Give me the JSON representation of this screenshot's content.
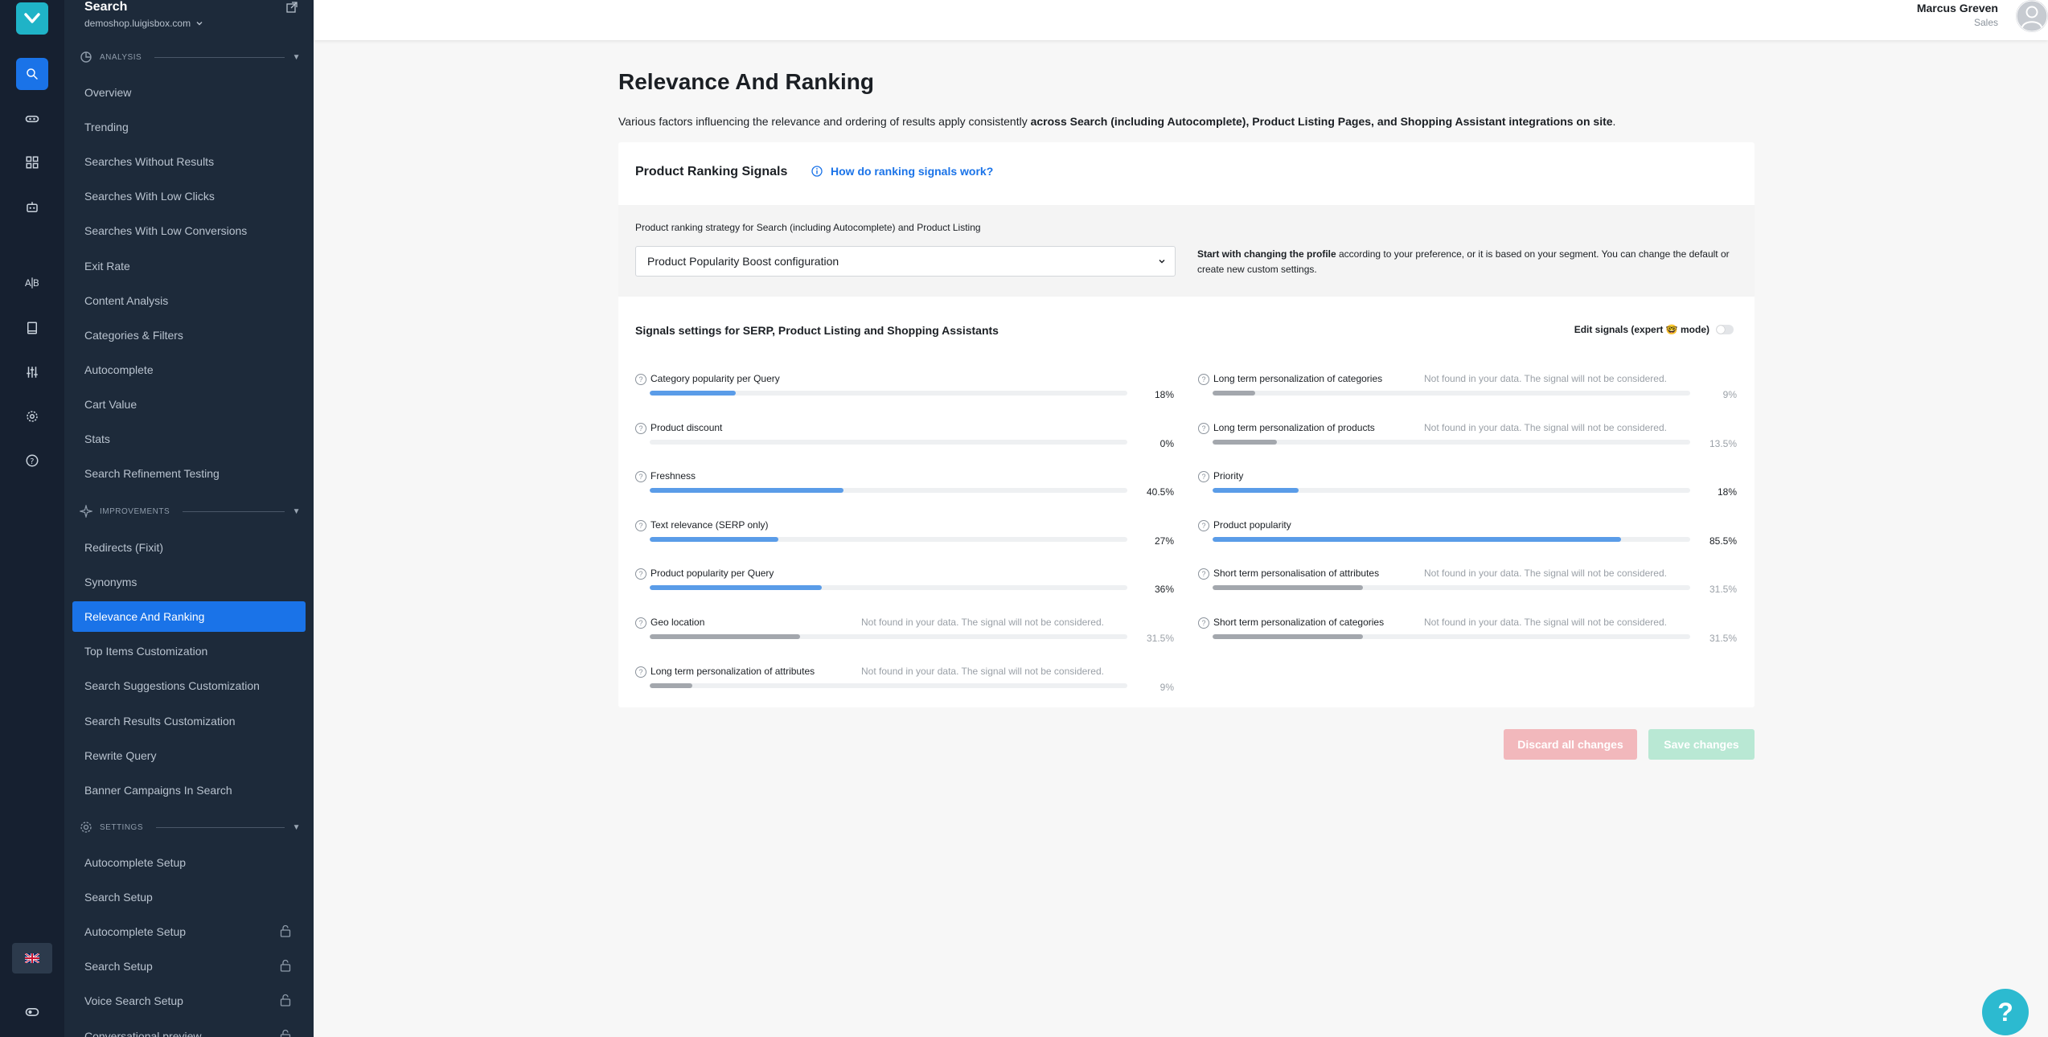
{
  "sidebar": {
    "title": "Search",
    "site": "demoshop.luigisbox.com",
    "sections": {
      "analysis": "ANALYSIS",
      "improvements": "IMPROVEMENTS",
      "settings": "SETTINGS"
    },
    "analysis_items": [
      {
        "label": "Overview"
      },
      {
        "label": "Trending"
      },
      {
        "label": "Searches Without Results"
      },
      {
        "label": "Searches With Low Clicks"
      },
      {
        "label": "Searches With Low Conversions"
      },
      {
        "label": "Exit Rate"
      },
      {
        "label": "Content Analysis"
      },
      {
        "label": "Categories & Filters"
      },
      {
        "label": "Autocomplete"
      },
      {
        "label": "Cart Value"
      },
      {
        "label": "Stats"
      },
      {
        "label": "Search Refinement Testing"
      }
    ],
    "improvement_items": [
      {
        "label": "Redirects (Fixit)"
      },
      {
        "label": "Synonyms"
      },
      {
        "label": "Relevance And Ranking"
      },
      {
        "label": "Top Items Customization"
      },
      {
        "label": "Search Suggestions Customization"
      },
      {
        "label": "Search Results Customization"
      },
      {
        "label": "Rewrite Query"
      },
      {
        "label": "Banner Campaigns In Search"
      }
    ],
    "settings_items": [
      {
        "label": "Autocomplete Setup"
      },
      {
        "label": "Search Setup"
      },
      {
        "label": "Autocomplete Setup"
      },
      {
        "label": "Search Setup"
      },
      {
        "label": "Voice Search Setup"
      },
      {
        "label": "Conversational preview"
      }
    ]
  },
  "header": {
    "user_name": "Marcus Greven",
    "user_role": "Sales"
  },
  "main": {
    "title": "Relevance And Ranking",
    "desc_prefix": "Various factors influencing the relevance and ordering of results apply consistently ",
    "desc_bold": "across Search (including Autocomplete), Product Listing Pages, and Shopping Assistant integrations on site",
    "desc_suffix": ".",
    "card_title": "Product Ranking Signals",
    "help_link": "How do ranking signals work?",
    "strategy_label": "Product ranking strategy for Search (including Autocomplete) and Product Listing",
    "strategy_value": "Product Popularity Boost configuration",
    "strategy_note_bold": "Start with changing the profile",
    "strategy_note_rest": " according to your preference, or it is based on your segment. You can change the default or create new custom settings.",
    "signals_title": "Signals settings for SERP, Product Listing and Shopping Assistants",
    "expert_label": "Edit signals (expert 🤓 mode)",
    "not_found_note": "Not found in your data. The signal will not be considered.",
    "signals_left": [
      {
        "name": "Category popularity per Query",
        "value": "18%",
        "fraction": 0.18,
        "found": true
      },
      {
        "name": "Product discount",
        "value": "0%",
        "fraction": 0.0,
        "found": true
      },
      {
        "name": "Freshness",
        "value": "40.5%",
        "fraction": 0.405,
        "found": true
      },
      {
        "name": "Text relevance (SERP only)",
        "value": "27%",
        "fraction": 0.27,
        "found": true
      },
      {
        "name": "Product popularity per Query",
        "value": "36%",
        "fraction": 0.36,
        "found": true
      },
      {
        "name": "Geo location",
        "value": "31.5%",
        "fraction": 0.315,
        "found": false
      },
      {
        "name": "Long term personalization of attributes",
        "value": "9%",
        "fraction": 0.09,
        "found": false
      }
    ],
    "signals_right": [
      {
        "name": "Long term personalization of categories",
        "value": "9%",
        "fraction": 0.09,
        "found": false
      },
      {
        "name": "Long term personalization of products",
        "value": "13.5%",
        "fraction": 0.135,
        "found": false
      },
      {
        "name": "Priority",
        "value": "18%",
        "fraction": 0.18,
        "found": true
      },
      {
        "name": "Product popularity",
        "value": "85.5%",
        "fraction": 0.855,
        "found": true
      },
      {
        "name": "Short term personalisation of attributes",
        "value": "31.5%",
        "fraction": 0.315,
        "found": false
      },
      {
        "name": "Short term personalization of categories",
        "value": "31.5%",
        "fraction": 0.315,
        "found": false
      }
    ],
    "discard_label": "Discard all changes",
    "save_label": "Save changes"
  },
  "help_fab": "?",
  "colors": {
    "accent": "#1a73e8",
    "teal": "#1fb3c7",
    "sidebar_bg": "#1d2a3a",
    "rail_bg": "#162030",
    "bar_fill": "#5a9ce8",
    "bar_disabled": "#a3a7ad"
  }
}
